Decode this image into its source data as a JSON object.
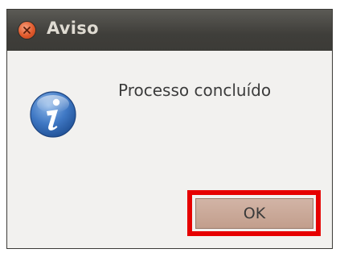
{
  "window": {
    "title": "Aviso"
  },
  "icons": {
    "close": "close-icon",
    "info": "info-icon"
  },
  "dialog": {
    "message": "Processo concluído",
    "ok_label": "OK"
  },
  "colors": {
    "titlebar": "#3c3b37",
    "close_button": "#e0592b",
    "highlight": "#e60000",
    "button": "#c8a898"
  }
}
